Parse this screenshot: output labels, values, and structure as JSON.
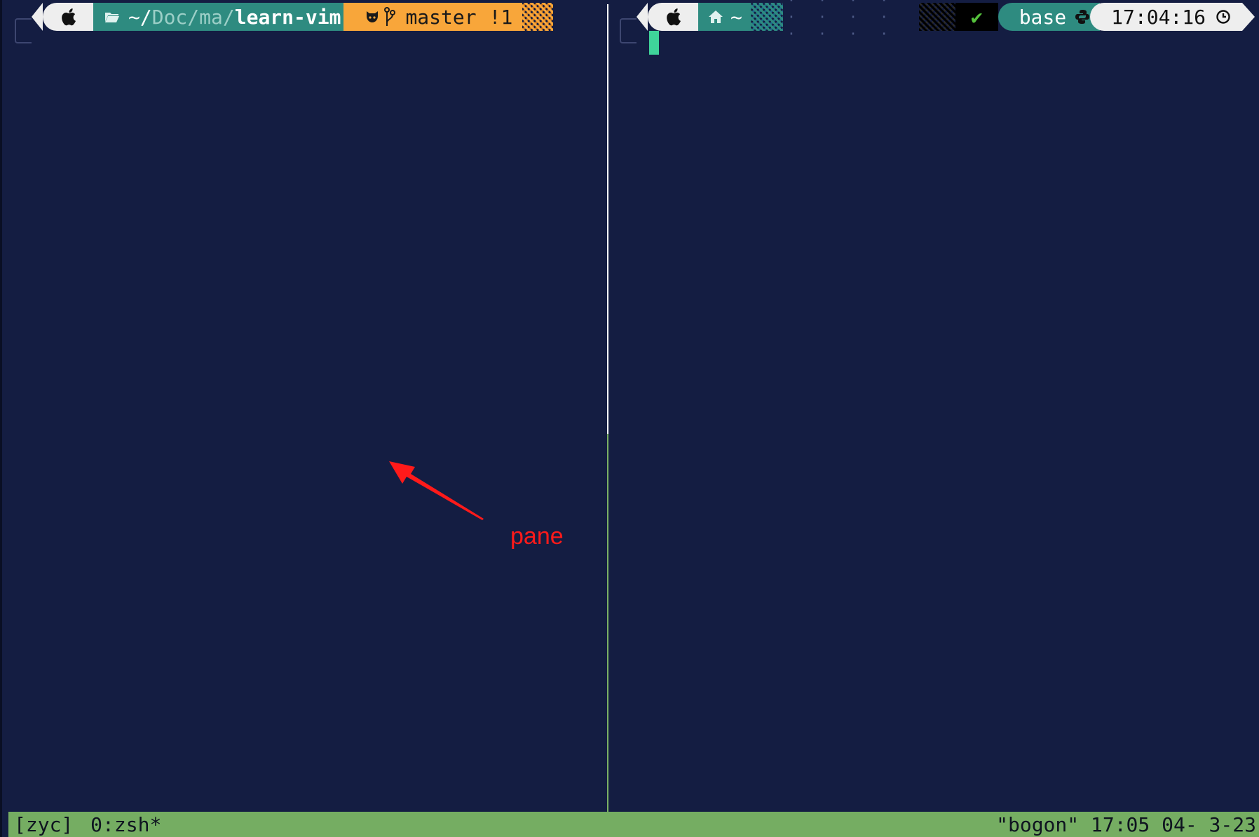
{
  "left_pane": {
    "prompt": {
      "apple_icon": "apple-icon",
      "folder_icon": "folder-icon",
      "path_tilde": "~/",
      "path_dim": "Doc/ma/",
      "path_bold": "learn-vim",
      "git_icon": "github-icon",
      "branch_icon": "branch-icon",
      "branch": "master",
      "changes": "!1"
    }
  },
  "right_pane": {
    "prompt": {
      "apple_icon": "apple-icon",
      "home_icon": "home-icon",
      "path": "~",
      "status_mark": "✔",
      "env": "base",
      "env_icon": "python-icon",
      "time": "17:04:16",
      "clock_icon": "clock-icon"
    }
  },
  "annotation": {
    "label": "pane",
    "color": "#ff1a1a"
  },
  "status_bar": {
    "session": "[zyc]",
    "window": "0:zsh*",
    "host_time": "\"bogon\" 17:05 04- 3-23",
    "color": "#75ad62"
  },
  "colors": {
    "background": "#141d42",
    "teal": "#2e8b80",
    "orange": "#f8a63a",
    "cursor": "#3fd39a"
  }
}
